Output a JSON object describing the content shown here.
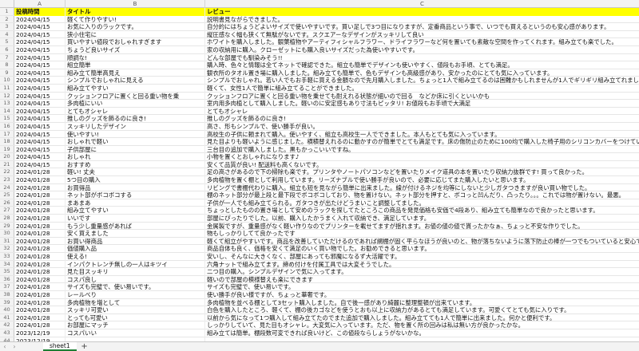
{
  "columns": [
    "A",
    "B",
    "C"
  ],
  "rows": [
    {
      "n": "1",
      "a": "投稿時間",
      "b": "タイトル",
      "c": "レビュー",
      "header": true
    },
    {
      "n": "2",
      "a": "2024/04/15",
      "b": "軽くて作りやすい!",
      "c": "説明書見ながらできました。"
    },
    {
      "n": "3",
      "a": "2024/04/15",
      "b": "お気に入りのラックです。",
      "c": "自分的にはちょうどよいサイズで使いやすいです。買い足しで3つ目になりますが、定番商品という事で、いつでも買えるというのも安心感があります。"
    },
    {
      "n": "4",
      "a": "2024/04/15",
      "b": "狭小住宅に",
      "c": "縦圧感なく幅も狭くて無駄がないです。スクエアーなデザインがスッキリして良い"
    },
    {
      "n": "5",
      "a": "2024/04/15",
      "b": "買いやすい値段でおしゃれすぎます",
      "c": "ホワイトを購入しました。観葉植物やアーティフィシャルフラワー、ドライフラワーなど何を置いても素敵な空間を作ってくれます。組み立ても楽でした。"
    },
    {
      "n": "6",
      "a": "2024/04/15",
      "b": "ちょうど良いサイズ",
      "c": "家の収納用に購入。クローゼットにも購入良いサイズだった為使いやすいです。"
    },
    {
      "n": "7",
      "a": "2024/04/15",
      "b": "順調な!",
      "c": "どんな部屋でも馴染みそう!!"
    },
    {
      "n": "8",
      "a": "2024/04/15",
      "b": "組立簡単",
      "c": "購入時、色々と情報は全てネットで確認できた。組立も簡単でデザインも使いやすく、値段もお手頃、とても満足。"
    },
    {
      "n": "9",
      "a": "2024/04/15",
      "b": "組み立て簡単高見え",
      "c": "観衣所のタオル置き場に購入しました。組み立ても簡単で、色もデザインも高級感があり、安かったのにとても気に入っています。"
    },
    {
      "n": "10",
      "a": "2024/04/15",
      "b": "シンプルでおしゃれに見える",
      "c": "シンプルでおしゃれ。若い人でもお手軽に買える金額なので先月購入しました。ちょっと1人で組み立てるのは困難かもしれませんが1人でギリギリ組み立てれました。"
    },
    {
      "n": "11",
      "a": "2024/04/15",
      "b": "組み立てやすい",
      "c": "軽くて、女性1人で簡単に組み立てることができました。"
    },
    {
      "n": "12",
      "a": "2024/04/15",
      "b": "クッションフロアに置くと回る重い物を乗",
      "c": "クッションフロアに置くと回る重い物を乗せても耐えれる状態が細いので回る　などか床に引くといいかも"
    },
    {
      "n": "13",
      "a": "2024/04/15",
      "b": "多肉植にいい",
      "c": "室内用多肉植として購入しました。軽いのに安定感もあり寸法もピッタリ! お値段もお手頃で大満足"
    },
    {
      "n": "14",
      "a": "2024/04/15",
      "b": "とてもオシャレ",
      "c": "とてもオシャレ"
    },
    {
      "n": "15",
      "a": "2024/04/15",
      "b": "推しのグッズを飾るのに良き!",
      "c": "推しのグッズを飾るのに良き!"
    },
    {
      "n": "16",
      "a": "2024/04/15",
      "b": "スッキリしたデザイン",
      "c": "高さ、形もシンプルで、使い勝手が良い。"
    },
    {
      "n": "17",
      "a": "2024/04/15",
      "b": "使いやすい!",
      "c": "高校生の子供に頼まれて購入。使いやすく、組立も高校生一人でできました。本人もとても気に入っています。"
    },
    {
      "n": "18",
      "a": "2024/04/15",
      "b": "おしゃれで軽い",
      "c": "見た目よりも軽いように感じました。横積替えれるのに動かすのが簡単でとても満足です。床の傷防止のために100均で購入した椅子用のシリコンカバーをつけています。"
    },
    {
      "n": "19",
      "a": "2024/04/15",
      "b": "子供部屋に",
      "c": "三台目の追加で購入しました。黒もかっこいいですね。"
    },
    {
      "n": "20",
      "a": "2024/04/15",
      "b": "おしゃれ",
      "c": "小物を置くとおしゃれになります♪"
    },
    {
      "n": "21",
      "a": "2024/04/15",
      "b": "おすすめ",
      "c": "安くて品質が良い! 配送料も高くないです。"
    },
    {
      "n": "22",
      "a": "2024/01/28",
      "b": "軽い! 丈夫",
      "c": "足の高さがあるので下の掃除も楽です。プリンタやノートパソコンなどを置いたりメイク道具の本を置いたり収納力抜群です! 買って良かった。"
    },
    {
      "n": "23",
      "a": "2024/01/28",
      "b": "5つ目の購入",
      "c": "多肉植物を置く棚として利用しています。リーズナブルで使い勝手が良いので、必要に応じてまた購入したいと思います。"
    },
    {
      "n": "24",
      "a": "2024/01/28",
      "b": "お買得品",
      "c": "リビングで書棚代わりに購入。組立も短を見ながら簡単に出来ました。線が付けるネジを均等にしないと少しガタつきますが良い買い物でした。"
    },
    {
      "n": "25",
      "a": "2024/01/28",
      "b": "ネット部がボコボコする",
      "c": "棚のネット部分が最上段と最下段でボコボコしており、物を置けない。ネット部分を押すと、ボコっと凹んだり、凸ったり。。。これでは物が置けない。最悪。"
    },
    {
      "n": "26",
      "a": "2024/01/28",
      "b": "まあまあ",
      "c": "子供が一人でも組み立てられる。ガタつきが出たけどうまいこと調整してました。"
    },
    {
      "n": "27",
      "a": "2024/01/28",
      "b": "組み立てやすい",
      "c": "ちょっとしたものの置き場として安めのラックを探してたところこの商品を発見価格も安価で4段あり、組み立ても簡単なので良かったと思います。"
    },
    {
      "n": "28",
      "a": "2024/01/28",
      "b": "いいです",
      "c": "部屋にぴったりでした。以前、購入したかうまく入れて収納でき、満足しています。"
    },
    {
      "n": "29",
      "a": "2024/01/28",
      "b": "もう少し重量感があれば",
      "c": "金属製ですが、重量感がなく軽い作りなのでプリンターを載せてますが揺れます。お値の値の値で貰ったかなぁ、ちょっと不安な作りでした。"
    },
    {
      "n": "30",
      "a": "2024/01/28",
      "b": "安く買えました",
      "c": "物もしっかりしてて良かったです"
    },
    {
      "n": "31",
      "a": "2024/01/28",
      "b": "お買い得商品",
      "c": "軽くて組立がやすいです。商品を改善していただけるのであれば網棚が固く平らなほうが良いのと、物が落ちないように落下防止の棒が一つでもついていると安心です。"
    },
    {
      "n": "32",
      "a": "2024/01/28",
      "b": "価値購入品",
      "c": "商品自体も良く、価格を安くて満足のいく買い物でした。お勧めできると思います。"
    },
    {
      "n": "33",
      "a": "2024/01/28",
      "b": "使える!",
      "c": "安いし、そんなに大きくなく、部屋にあっても邪魔になるず大活躍です。"
    },
    {
      "n": "34",
      "a": "2024/01/28",
      "b": "インパクトレンチ無しの一人はキツイ",
      "c": "六角ナットで組み立てます。締め付けを付属工具では大変そうでした。"
    },
    {
      "n": "35",
      "a": "2024/01/28",
      "b": "見た目スッキリ",
      "c": "二つ目の購入。シンプルデザインで気に入ってます。"
    },
    {
      "n": "36",
      "a": "2024/01/28",
      "b": "コスパ良し",
      "c": "軽いので部屋の模様替えも楽にできます"
    },
    {
      "n": "37",
      "a": "2024/01/28",
      "b": "サイズも完璧で、使い易いです。",
      "c": "サイズも完璧で、使い易いです。"
    },
    {
      "n": "38",
      "a": "2024/01/28",
      "b": "レールべり",
      "c": "使い勝手が良い様ですが、ちょっと華奢です。"
    },
    {
      "n": "39",
      "a": "2024/01/28",
      "b": "多肉植物を増として",
      "c": "多肉植物を並べる棚として3セット購入しました。自で後一感があり綺麗に整理整頓が出来ています。"
    },
    {
      "n": "40",
      "a": "2024/01/28",
      "b": "スッキリ可愛い",
      "c": "白色を購入したところ、軽くて、棚の後カゴなどを使うとおも以上に収納力があるとても満足しています。可愛くてとても気に入りです。"
    },
    {
      "n": "41",
      "a": "2024/01/28",
      "b": "とっても可愛い",
      "c": "以前から気になって1つ購入して組み立てたのでまた追加で購入しました。組み立てても1人で簡単に出来ました。何かと便利です。"
    },
    {
      "n": "42",
      "a": "2024/01/28",
      "b": "お部屋にマッチ",
      "c": "しっかりしていて、見た目もオシャレ。大変気に入っています。ただ、物を置く所の回みは私は無い方が良かったかな。"
    },
    {
      "n": "43",
      "a": "2023/12/19",
      "b": "コスパいい",
      "c": "組み立ては簡単。棚段数可変できれば良いけど、この値段ならしょうがないかな。"
    },
    {
      "n": "44",
      "a": "2023/12/19",
      "b": "",
      "c": ""
    }
  ],
  "sheet_tab": "sheet1",
  "add_sheet_label": "+",
  "nav_prev": "‹",
  "nav_next": "›"
}
